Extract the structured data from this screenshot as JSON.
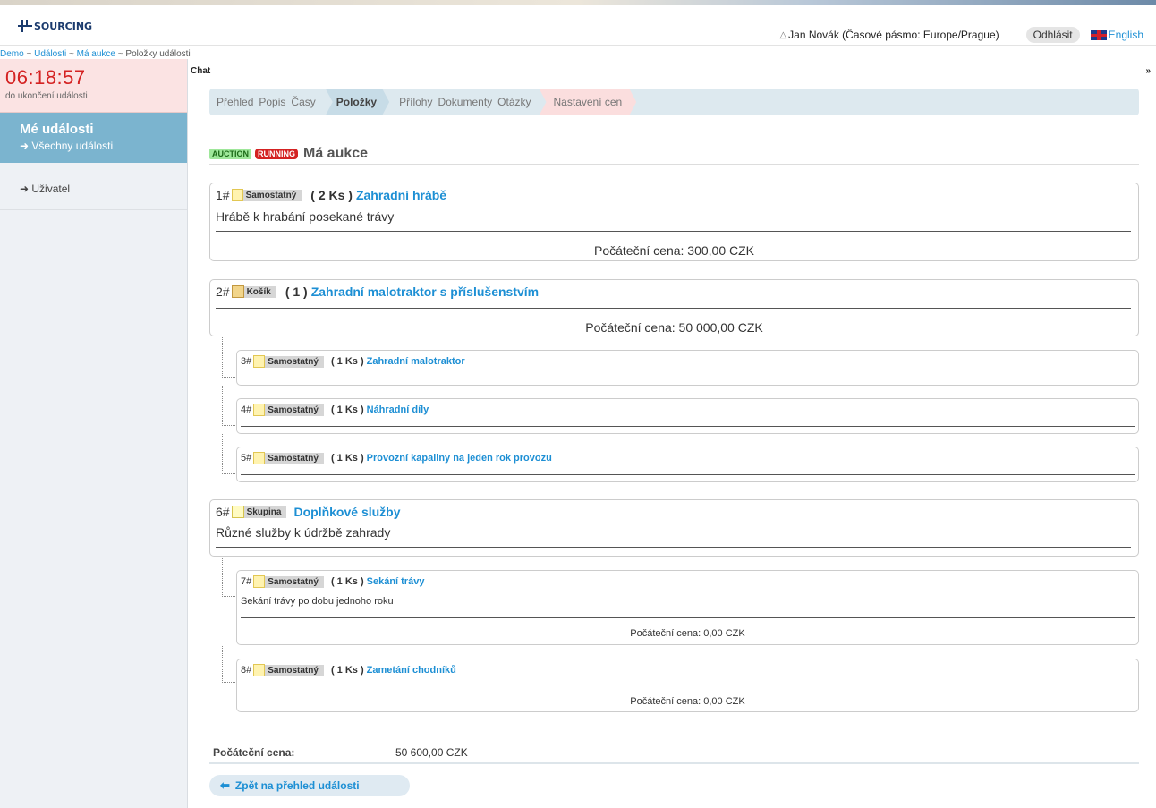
{
  "header": {
    "logo_text": "SOURCING",
    "user": "Jan Novák (Časové pásmo: Europe/Prague)",
    "logout": "Odhlásit",
    "language": "English"
  },
  "breadcrumb": {
    "items": [
      "Demo",
      "Události",
      "Má aukce",
      "Položky události"
    ]
  },
  "sidebar": {
    "timer": "06:18:57",
    "timer_label": "do ukončení události",
    "section_title": "Mé události",
    "section_link": "➜ Všechny události",
    "user_link": "➜ Uživatel"
  },
  "chat": {
    "label": "Chat",
    "toggle": "»"
  },
  "tabs": [
    {
      "label": "Přehled"
    },
    {
      "label": "Popis"
    },
    {
      "label": "Časy"
    },
    {
      "label": "Položky"
    },
    {
      "label": "Přílohy"
    },
    {
      "label": "Dokumenty"
    },
    {
      "label": "Otázky"
    },
    {
      "label": "Nastavení cen"
    }
  ],
  "event": {
    "badge_type": "AUCTION",
    "badge_status": "RUNNING",
    "title": "Má aukce"
  },
  "items": [
    {
      "num": "1#",
      "type": "Samostatný",
      "qty": "( 2 Ks )",
      "name": "Zahradní hrábě",
      "desc": "Hrábě k hrabání posekané trávy",
      "price": "Počáteční cena: 300,00 CZK"
    },
    {
      "num": "2#",
      "type": "Košík",
      "qty": "( 1 )",
      "name": "Zahradní malotraktor s příslušenstvím",
      "desc": "",
      "price": "Počáteční cena: 50 000,00 CZK"
    },
    {
      "num": "3#",
      "type": "Samostatný",
      "qty": "( 1 Ks )",
      "name": "Zahradní malotraktor"
    },
    {
      "num": "4#",
      "type": "Samostatný",
      "qty": "( 1 Ks )",
      "name": "Náhradní díly"
    },
    {
      "num": "5#",
      "type": "Samostatný",
      "qty": "( 1 Ks )",
      "name": "Provozní kapaliny na jeden rok provozu"
    },
    {
      "num": "6#",
      "type": "Skupina",
      "qty": "",
      "name": "Doplňkové služby",
      "desc": "Různé služby k údržbě zahrady"
    },
    {
      "num": "7#",
      "type": "Samostatný",
      "qty": "( 1 Ks )",
      "name": "Sekání trávy",
      "desc": "Sekání trávy po dobu jednoho roku",
      "price": "Počáteční cena: 0,00 CZK"
    },
    {
      "num": "8#",
      "type": "Samostatný",
      "qty": "( 1 Ks )",
      "name": "Zametání chodníků",
      "price": "Počáteční cena: 0,00 CZK"
    }
  ],
  "summary": {
    "label": "Počáteční cena:",
    "value": "50 600,00 CZK"
  },
  "back_button": {
    "icon": "arrow-left-icon",
    "label": "Zpět na přehled události"
  },
  "colors": {
    "accent": "#1d8fd4",
    "timer": "#d42222",
    "sidebar_active": "#7bb4cf"
  }
}
